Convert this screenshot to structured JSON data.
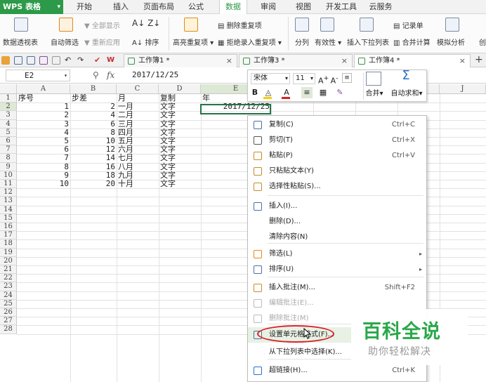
{
  "app": {
    "name": "WPS 表格"
  },
  "menu_tabs": [
    "开始",
    "插入",
    "页面布局",
    "公式",
    "数据",
    "审阅",
    "视图",
    "开发工具",
    "云服务"
  ],
  "active_menu": "数据",
  "ribbon": {
    "pivot": "数据透视表",
    "autofilter": "自动筛选",
    "show_all": "全部显示",
    "reapply": "重新应用",
    "sort": "排序",
    "highlight_dup": "高亮重复项",
    "delete_dup": "删除重复项",
    "reject_dup": "拒绝录入重复项",
    "split": "分列",
    "validity": "有效性",
    "insert_dropdown": "插入下拉列表",
    "merge_calc": "合并计算",
    "record": "记录单",
    "simulate": "模拟分析",
    "create": "创"
  },
  "doc_tabs": [
    {
      "label": "工作簿1 *",
      "active": false
    },
    {
      "label": "工作簿3 *",
      "active": false
    },
    {
      "label": "工作簿4 *",
      "active": true
    }
  ],
  "formula_bar": {
    "name_box": "E2",
    "fx": "fx",
    "value": "2017/12/25"
  },
  "columns": [
    "A",
    "B",
    "C",
    "D",
    "E",
    "F",
    "G",
    "H",
    "I",
    "J"
  ],
  "rows": [
    "1",
    "2",
    "3",
    "4",
    "5",
    "6",
    "7",
    "8",
    "9",
    "10",
    "11",
    "12",
    "13",
    "14",
    "15",
    "16",
    "17",
    "18",
    "19",
    "20",
    "21",
    "22",
    "23",
    "24",
    "25",
    "26",
    "27",
    "28"
  ],
  "headers": {
    "a": "序号",
    "b": "步差",
    "c": "月",
    "d": "复制",
    "e": "年"
  },
  "table": [
    {
      "a": "1",
      "b": "2",
      "c": "一月",
      "d": "文字"
    },
    {
      "a": "2",
      "b": "4",
      "c": "二月",
      "d": "文字"
    },
    {
      "a": "3",
      "b": "6",
      "c": "三月",
      "d": "文字"
    },
    {
      "a": "4",
      "b": "8",
      "c": "四月",
      "d": "文字"
    },
    {
      "a": "5",
      "b": "10",
      "c": "五月",
      "d": "文字"
    },
    {
      "a": "6",
      "b": "12",
      "c": "六月",
      "d": "文字"
    },
    {
      "a": "7",
      "b": "14",
      "c": "七月",
      "d": "文字"
    },
    {
      "a": "8",
      "b": "16",
      "c": "八月",
      "d": "文字"
    },
    {
      "a": "9",
      "b": "18",
      "c": "九月",
      "d": "文字"
    },
    {
      "a": "10",
      "b": "20",
      "c": "十月",
      "d": "文字"
    }
  ],
  "e2_value": "2017/12/25",
  "mini_toolbar": {
    "font": "宋体",
    "size": "11",
    "bold": "B",
    "merge": "合并",
    "autosum": "自动求和"
  },
  "context_menu": [
    {
      "label": "复制(C)",
      "shortcut": "Ctrl+C",
      "icon": "copy-icon"
    },
    {
      "label": "剪切(T)",
      "shortcut": "Ctrl+X",
      "icon": "scissors-icon"
    },
    {
      "label": "粘贴(P)",
      "shortcut": "Ctrl+V",
      "icon": "paste-icon"
    },
    {
      "label": "只粘贴文本(Y)",
      "shortcut": "",
      "icon": "paste-text-icon"
    },
    {
      "label": "选择性粘贴(S)...",
      "shortcut": "",
      "icon": "paste-special-icon"
    },
    {
      "label": "插入(I)...",
      "shortcut": "",
      "icon": "insert-icon"
    },
    {
      "label": "删除(D)...",
      "shortcut": "",
      "icon": ""
    },
    {
      "label": "清除内容(N)",
      "shortcut": "",
      "icon": ""
    },
    {
      "label": "筛选(L)",
      "shortcut": "",
      "icon": "filter-icon",
      "submenu": true
    },
    {
      "label": "排序(U)",
      "shortcut": "",
      "icon": "sort-icon",
      "submenu": true
    },
    {
      "label": "插入批注(M)...",
      "shortcut": "Shift+F2",
      "icon": "comment-icon"
    },
    {
      "label": "编辑批注(E)...",
      "shortcut": "",
      "icon": "edit-comment-icon",
      "disabled": true
    },
    {
      "label": "删除批注(M)",
      "shortcut": "",
      "icon": "delete-comment-icon",
      "disabled": true
    },
    {
      "label": "设置单元格格式(F)...",
      "shortcut": "",
      "icon": "format-cells-icon"
    },
    {
      "label": "从下拉列表中选择(K)...",
      "shortcut": "",
      "icon": ""
    },
    {
      "label": "超链接(H)...",
      "shortcut": "Ctrl+K",
      "icon": "hyperlink-icon"
    }
  ],
  "watermark": {
    "title": "百科全说",
    "subtitle": "助你轻松解决"
  },
  "colors": {
    "wps_green": "#2c9a48",
    "highlight_ring": "#d8202a",
    "selection": "#217346"
  }
}
